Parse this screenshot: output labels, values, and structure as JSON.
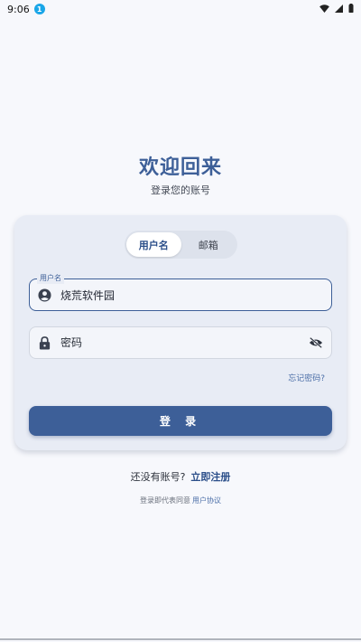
{
  "status_bar": {
    "time": "9:06",
    "notification_badge": "1"
  },
  "header": {
    "title": "欢迎回来",
    "subtitle": "登录您的账号"
  },
  "login_card": {
    "tabs": [
      {
        "label": "用户名",
        "active": true
      },
      {
        "label": "邮箱",
        "active": false
      }
    ],
    "username_field": {
      "label": "用户名",
      "value": "烧荒软件园",
      "icon": "account-circle-icon"
    },
    "password_field": {
      "placeholder": "密码",
      "icon": "lock-icon",
      "toggle_icon": "eye-off-icon"
    },
    "forgot_password": "忘记密码?",
    "login_button": "登 录"
  },
  "register": {
    "prompt": "还没有账号?",
    "link": "立即注册"
  },
  "agreement": {
    "text": "登录即代表同意",
    "link": "用户协议"
  },
  "colors": {
    "primary": "#3d5f98",
    "background": "#f7f8fc",
    "card": "#e8ecf5"
  }
}
